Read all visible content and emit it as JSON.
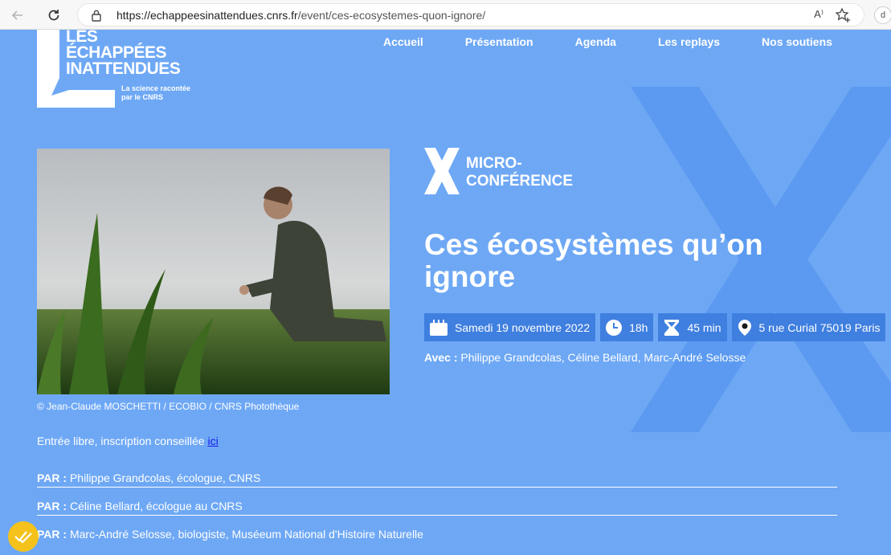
{
  "browser": {
    "url_domain": "https://echappeesinattendues.cnrs.fr",
    "url_path": "/event/ces-ecosystemes-quon-ignore/",
    "read_aloud": "A⁾",
    "ext_label": "d"
  },
  "logo": {
    "line1": "LES",
    "line2": "ÉCHAPPÉES",
    "line3": "INATTENDUES",
    "sub_line1": "La science racontée",
    "sub_line2": "par le CNRS"
  },
  "nav": [
    "Accueil",
    "Présentation",
    "Agenda",
    "Les replays",
    "Nos soutiens"
  ],
  "photo_credit": "© Jean-Claude MOSCHETTI / ECOBIO / CNRS Photothèque",
  "category": {
    "line1": "MICRO-",
    "line2": "CONFÉRENCE"
  },
  "title": "Ces écosystèmes qu’on ignore",
  "infos": {
    "date": "Samedi 19 novembre 2022",
    "time": "18h",
    "duration": "45 min",
    "place": "5 rue Curial 75019 Paris"
  },
  "avec": {
    "label": "Avec :",
    "names": "Philippe Grandcolas, Céline Bellard, Marc-André Selosse"
  },
  "entree": {
    "text": "Entrée libre, inscription conseillée ",
    "link": "ici"
  },
  "par": [
    {
      "label": "PAR :",
      "text": "Philippe Grandcolas, écologue, CNRS"
    },
    {
      "label": "PAR :",
      "text": "Céline Bellard, écologue au CNRS"
    },
    {
      "label": "PAR :",
      "text": "Marc-André Selosse, biologiste, Muséeum National d'Histoire Naturelle"
    }
  ],
  "colors": {
    "background": "#6ea8f5",
    "accent": "#3f7fe0",
    "badge": "#f4c21b"
  }
}
